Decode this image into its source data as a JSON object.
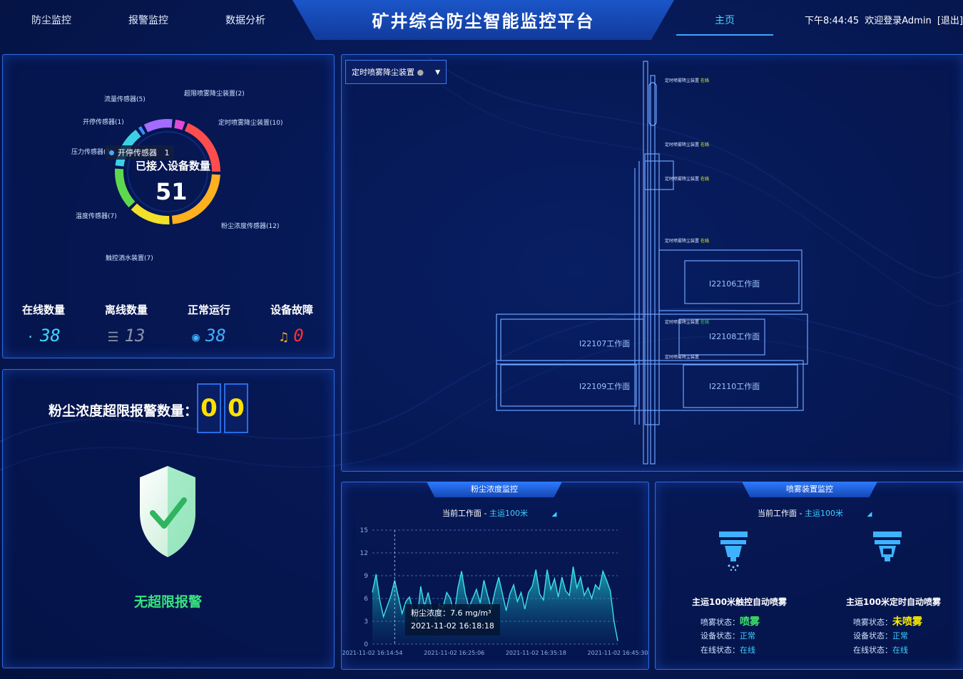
{
  "nav": {
    "items": [
      "防尘监控",
      "报警监控",
      "数据分析"
    ],
    "home": "主页"
  },
  "header": {
    "title": "矿井综合防尘智能监控平台",
    "time": "下午8:44:45",
    "welcome": "欢迎登录Admin",
    "logout": "[退出]"
  },
  "device_summary": {
    "center_title": "已接入设备数量",
    "total": "51",
    "tooltip": {
      "name": "开停传感器",
      "value": "1"
    },
    "segments": [
      {
        "label": "超限喷雾降尘装置(2)",
        "value": 2,
        "color": "#e14ad6"
      },
      {
        "label": "定时喷雾降尘装置(10)",
        "value": 10,
        "color": "#ff4d4d"
      },
      {
        "label": "粉尘浓度传感器(12)",
        "value": 12,
        "color": "#ffb020"
      },
      {
        "label": "触控洒水装置(7)",
        "value": 7,
        "color": "#f2e02a"
      },
      {
        "label": "温度传感器(7)",
        "value": 7,
        "color": "#5ed84f"
      },
      {
        "label": "压力传感器(7)",
        "value": 7,
        "color": "#3ad1e6"
      },
      {
        "label": "开停传感器(1)",
        "value": 1,
        "color": "#3c8cff"
      },
      {
        "label": "流量传感器(5)",
        "value": 5,
        "color": "#a36bff"
      }
    ],
    "stats": [
      {
        "label": "在线数量",
        "value": "38",
        "icon": "wifi-icon",
        "color": "#3fd7ff"
      },
      {
        "label": "离线数量",
        "value": "13",
        "icon": "wifi-off-icon",
        "color": "#8a93a8"
      },
      {
        "label": "正常运行",
        "value": "38",
        "icon": "normal-ring-icon",
        "color": "#3fb2ff"
      },
      {
        "label": "设备故障",
        "value": "0",
        "icon": "bell-icon",
        "color": "#ff2f2f"
      }
    ]
  },
  "alarm": {
    "label": "粉尘浓度超限报警数量：",
    "digits": [
      "0",
      "0"
    ],
    "status": "无超限报警"
  },
  "map": {
    "selector": "定时喷雾降尘装置",
    "faces": [
      "I22106工作面",
      "I22107工作面",
      "I22108工作面",
      "I22109工作面",
      "I22110工作面"
    ],
    "sensor_labels": [
      "定时喷雾降尘装置",
      "定时喷雾降尘装置",
      "定时喷雾降尘装置",
      "定时喷雾降尘装置",
      "定时喷雾降尘装置",
      "定时喷雾降尘装置"
    ],
    "status_tag": "在线"
  },
  "dust_chart_panel": {
    "title": "粉尘浓度监控",
    "workface_label": "当前工作面 -",
    "workface_value": "主运100米"
  },
  "chart_data": {
    "type": "area",
    "title": "",
    "xlabel": "",
    "ylabel": "",
    "ylim": [
      0,
      15
    ],
    "yticks": [
      0,
      3,
      6,
      9,
      12,
      15
    ],
    "xticks": [
      "2021-11-02 16:14:54",
      "2021-11-02 16:25:06",
      "2021-11-02 16:35:18",
      "2021-11-02 16:45:30"
    ],
    "series": [
      {
        "values": [
          6.8,
          9.2,
          5.8,
          3.6,
          5.0,
          6.4,
          8.4,
          6.2,
          4.0,
          5.6,
          6.2,
          4.2,
          3.0,
          7.6,
          5.0,
          6.8,
          4.6,
          3.2,
          5.2,
          4.8,
          6.8,
          6.0,
          3.8,
          7.4,
          9.6,
          6.6,
          4.8,
          6.0,
          7.2,
          5.4,
          8.4,
          6.4,
          4.6,
          7.0,
          8.8,
          6.6,
          4.4,
          6.6,
          7.8,
          5.6,
          6.8,
          4.6,
          6.8,
          7.6,
          9.8,
          6.6,
          5.8,
          9.8,
          7.2,
          8.6,
          6.2,
          8.8,
          7.0,
          6.4,
          10.2,
          7.4,
          8.8,
          6.4,
          7.4,
          6.0,
          7.8,
          7.2,
          9.6,
          8.4,
          7.0,
          3.0,
          0.4
        ]
      }
    ],
    "tooltip": {
      "line1": "粉尘浓度：7.6 mg/m³",
      "line2": "2021-11-02 16:18:18"
    }
  },
  "spray_panel": {
    "title": "喷雾装置监控",
    "workface_label": "当前工作面 -",
    "workface_value": "主运100米",
    "devices": [
      {
        "name": "主运100米触控自动喷雾",
        "spray_label": "喷雾状态：",
        "spray_value": "喷雾",
        "device_label": "设备状态：",
        "device_value": "正常",
        "online_label": "在线状态：",
        "online_value": "在线"
      },
      {
        "name": "主运100米定时自动喷雾",
        "spray_label": "喷雾状态：",
        "spray_value": "未喷雾",
        "device_label": "设备状态：",
        "device_value": "正常",
        "online_label": "在线状态：",
        "online_value": "在线"
      }
    ]
  }
}
